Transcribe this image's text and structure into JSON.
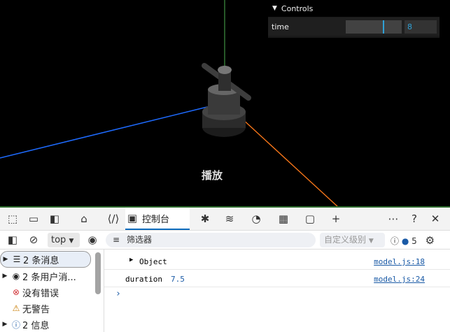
{
  "viewport": {
    "play_label": "播放"
  },
  "gui": {
    "header": "Controls",
    "time_label": "time",
    "time_value": "8",
    "time_fraction": 0.66
  },
  "devtools": {
    "tabs": [
      {
        "name": "inspect-icon"
      },
      {
        "name": "device-icon"
      },
      {
        "name": "dock-icon"
      },
      {
        "name": "home-icon"
      },
      {
        "name": "elements-icon"
      },
      {
        "name": "console-icon",
        "label": "控制台"
      },
      {
        "name": "sources-icon"
      },
      {
        "name": "network-icon"
      },
      {
        "name": "performance-icon"
      },
      {
        "name": "memory-icon"
      },
      {
        "name": "application-icon"
      },
      {
        "name": "add-icon"
      }
    ],
    "toolbar": {
      "context": "top",
      "filter_placeholder": "筛选器",
      "levels": "自定义级别",
      "issues_count": "5"
    },
    "sidebar": [
      {
        "label": "2 条消息",
        "icon": "list-icon"
      },
      {
        "label": "2 条用户消...",
        "icon": "user-icon"
      },
      {
        "label": "没有错误",
        "icon": "error-icon"
      },
      {
        "label": "无警告",
        "icon": "warning-icon"
      },
      {
        "label": "2 信息",
        "icon": "info-icon"
      }
    ],
    "log": [
      {
        "text": "Object",
        "source": "model.js:18"
      },
      {
        "key": "duration",
        "value": "7.5",
        "source": "model.js:24"
      }
    ]
  }
}
